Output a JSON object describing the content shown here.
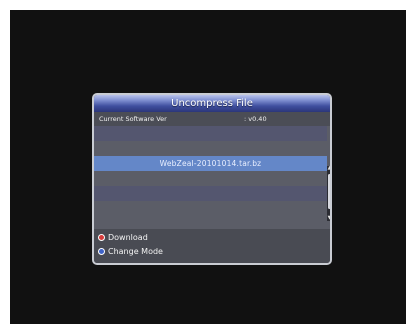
{
  "dialog": {
    "title": "Uncompress File",
    "info": {
      "label": "Current Software Ver",
      "value": ": v0.40"
    },
    "list": {
      "selected_item": "WebZeal-20101014.tar.bz"
    },
    "footer": {
      "download_label": "Download",
      "change_mode_label": "Change Mode"
    }
  },
  "colors": {
    "download_dot": "#d63b3b",
    "change_mode_dot": "#3f63c8"
  }
}
